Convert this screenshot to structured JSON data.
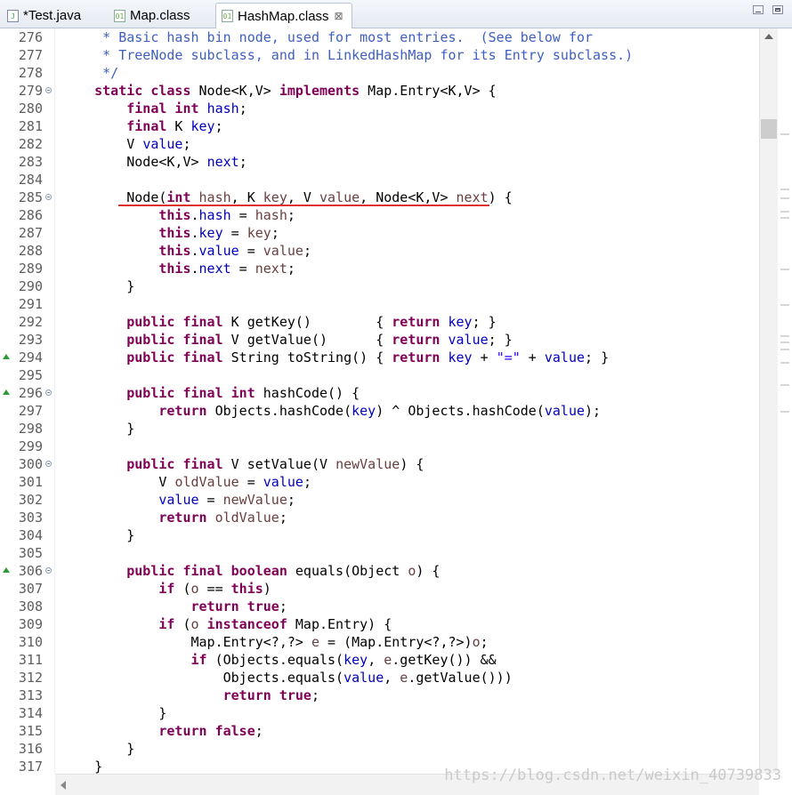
{
  "tabs": [
    {
      "label": "*Test.java",
      "icon": "java-file-icon",
      "active": false
    },
    {
      "label": "Map.class",
      "icon": "class-file-icon",
      "active": false
    },
    {
      "label": "HashMap.class",
      "icon": "class-file-icon",
      "active": true
    }
  ],
  "close_glyph": "⊠",
  "watermark": "https://blog.csdn.net/weixin_40739833",
  "colors": {
    "keyword": "#7f0055",
    "comment": "#3f5fbf",
    "field": "#0000c0",
    "param": "#6a3e3e",
    "string": "#2a00ff",
    "underline": "#e0302e"
  },
  "lines": [
    {
      "n": "276",
      "fold": false,
      "ovr": false,
      "t": [
        [
          "cm",
          "     * Basic hash bin node, used for most entries.  (See below for"
        ]
      ]
    },
    {
      "n": "277",
      "fold": false,
      "ovr": false,
      "t": [
        [
          "cm",
          "     * TreeNode subclass, and in LinkedHashMap for its Entry subclass.)"
        ]
      ]
    },
    {
      "n": "278",
      "fold": false,
      "ovr": false,
      "t": [
        [
          "cm",
          "     */"
        ]
      ]
    },
    {
      "n": "279",
      "fold": true,
      "ovr": false,
      "t": [
        [
          "",
          "    "
        ],
        [
          "kw",
          "static class"
        ],
        [
          "",
          " Node<K,V> "
        ],
        [
          "kw",
          "implements"
        ],
        [
          "",
          " Map.Entry<K,V> {"
        ]
      ]
    },
    {
      "n": "280",
      "fold": false,
      "ovr": false,
      "t": [
        [
          "",
          "        "
        ],
        [
          "kw",
          "final int"
        ],
        [
          "",
          " "
        ],
        [
          "fd",
          "hash"
        ],
        [
          "",
          ";"
        ]
      ]
    },
    {
      "n": "281",
      "fold": false,
      "ovr": false,
      "t": [
        [
          "",
          "        "
        ],
        [
          "kw",
          "final"
        ],
        [
          "",
          " K "
        ],
        [
          "fd",
          "key"
        ],
        [
          "",
          ";"
        ]
      ]
    },
    {
      "n": "282",
      "fold": false,
      "ovr": false,
      "t": [
        [
          "",
          "        V "
        ],
        [
          "fd",
          "value"
        ],
        [
          "",
          ";"
        ]
      ]
    },
    {
      "n": "283",
      "fold": false,
      "ovr": false,
      "t": [
        [
          "",
          "        Node<K,V> "
        ],
        [
          "fd",
          "next"
        ],
        [
          "",
          ";"
        ]
      ]
    },
    {
      "n": "284",
      "fold": false,
      "ovr": false,
      "t": [
        [
          "",
          ""
        ]
      ]
    },
    {
      "n": "285",
      "fold": true,
      "ovr": false,
      "t": [
        [
          "",
          "        Node("
        ],
        [
          "kw",
          "int"
        ],
        [
          "",
          " "
        ],
        [
          "pm",
          "hash"
        ],
        [
          "",
          ", K "
        ],
        [
          "pm",
          "key"
        ],
        [
          "",
          ", V "
        ],
        [
          "pm",
          "value"
        ],
        [
          "",
          ", Node<K,V> "
        ],
        [
          "pm",
          "next"
        ],
        [
          "",
          ") {"
        ]
      ]
    },
    {
      "n": "286",
      "fold": false,
      "ovr": false,
      "t": [
        [
          "",
          "            "
        ],
        [
          "kw",
          "this"
        ],
        [
          "",
          "."
        ],
        [
          "fd",
          "hash"
        ],
        [
          "",
          " = "
        ],
        [
          "pm",
          "hash"
        ],
        [
          "",
          ";"
        ]
      ]
    },
    {
      "n": "287",
      "fold": false,
      "ovr": false,
      "t": [
        [
          "",
          "            "
        ],
        [
          "kw",
          "this"
        ],
        [
          "",
          "."
        ],
        [
          "fd",
          "key"
        ],
        [
          "",
          " = "
        ],
        [
          "pm",
          "key"
        ],
        [
          "",
          ";"
        ]
      ]
    },
    {
      "n": "288",
      "fold": false,
      "ovr": false,
      "t": [
        [
          "",
          "            "
        ],
        [
          "kw",
          "this"
        ],
        [
          "",
          "."
        ],
        [
          "fd",
          "value"
        ],
        [
          "",
          " = "
        ],
        [
          "pm",
          "value"
        ],
        [
          "",
          ";"
        ]
      ]
    },
    {
      "n": "289",
      "fold": false,
      "ovr": false,
      "t": [
        [
          "",
          "            "
        ],
        [
          "kw",
          "this"
        ],
        [
          "",
          "."
        ],
        [
          "fd",
          "next"
        ],
        [
          "",
          " = "
        ],
        [
          "pm",
          "next"
        ],
        [
          "",
          ";"
        ]
      ]
    },
    {
      "n": "290",
      "fold": false,
      "ovr": false,
      "t": [
        [
          "",
          "        }"
        ]
      ]
    },
    {
      "n": "291",
      "fold": false,
      "ovr": false,
      "t": [
        [
          "",
          ""
        ]
      ]
    },
    {
      "n": "292",
      "fold": false,
      "ovr": false,
      "t": [
        [
          "",
          "        "
        ],
        [
          "kw",
          "public final"
        ],
        [
          "",
          " K getKey()        { "
        ],
        [
          "kw",
          "return"
        ],
        [
          "",
          " "
        ],
        [
          "fd",
          "key"
        ],
        [
          "",
          "; }"
        ]
      ]
    },
    {
      "n": "293",
      "fold": false,
      "ovr": false,
      "t": [
        [
          "",
          "        "
        ],
        [
          "kw",
          "public final"
        ],
        [
          "",
          " V getValue()      { "
        ],
        [
          "kw",
          "return"
        ],
        [
          "",
          " "
        ],
        [
          "fd",
          "value"
        ],
        [
          "",
          "; }"
        ]
      ]
    },
    {
      "n": "294",
      "fold": false,
      "ovr": true,
      "t": [
        [
          "",
          "        "
        ],
        [
          "kw",
          "public final"
        ],
        [
          "",
          " String toString() { "
        ],
        [
          "kw",
          "return"
        ],
        [
          "",
          " "
        ],
        [
          "fd",
          "key"
        ],
        [
          "",
          " + "
        ],
        [
          "st",
          "\"=\""
        ],
        [
          "",
          " + "
        ],
        [
          "fd",
          "value"
        ],
        [
          "",
          "; }"
        ]
      ]
    },
    {
      "n": "295",
      "fold": false,
      "ovr": false,
      "t": [
        [
          "",
          ""
        ]
      ]
    },
    {
      "n": "296",
      "fold": true,
      "ovr": true,
      "t": [
        [
          "",
          "        "
        ],
        [
          "kw",
          "public final int"
        ],
        [
          "",
          " hashCode() {"
        ]
      ]
    },
    {
      "n": "297",
      "fold": false,
      "ovr": false,
      "t": [
        [
          "",
          "            "
        ],
        [
          "kw",
          "return"
        ],
        [
          "",
          " Objects.hashCode("
        ],
        [
          "fd",
          "key"
        ],
        [
          "",
          ") ^ Objects.hashCode("
        ],
        [
          "fd",
          "value"
        ],
        [
          "",
          ");"
        ]
      ]
    },
    {
      "n": "298",
      "fold": false,
      "ovr": false,
      "t": [
        [
          "",
          "        }"
        ]
      ]
    },
    {
      "n": "299",
      "fold": false,
      "ovr": false,
      "t": [
        [
          "",
          ""
        ]
      ]
    },
    {
      "n": "300",
      "fold": true,
      "ovr": false,
      "t": [
        [
          "",
          "        "
        ],
        [
          "kw",
          "public final"
        ],
        [
          "",
          " V setValue(V "
        ],
        [
          "pm",
          "newValue"
        ],
        [
          "",
          ") {"
        ]
      ]
    },
    {
      "n": "301",
      "fold": false,
      "ovr": false,
      "t": [
        [
          "",
          "            V "
        ],
        [
          "pm",
          "oldValue"
        ],
        [
          "",
          " = "
        ],
        [
          "fd",
          "value"
        ],
        [
          "",
          ";"
        ]
      ]
    },
    {
      "n": "302",
      "fold": false,
      "ovr": false,
      "t": [
        [
          "",
          "            "
        ],
        [
          "fd",
          "value"
        ],
        [
          "",
          " = "
        ],
        [
          "pm",
          "newValue"
        ],
        [
          "",
          ";"
        ]
      ]
    },
    {
      "n": "303",
      "fold": false,
      "ovr": false,
      "t": [
        [
          "",
          "            "
        ],
        [
          "kw",
          "return"
        ],
        [
          "",
          " "
        ],
        [
          "pm",
          "oldValue"
        ],
        [
          "",
          ";"
        ]
      ]
    },
    {
      "n": "304",
      "fold": false,
      "ovr": false,
      "t": [
        [
          "",
          "        }"
        ]
      ]
    },
    {
      "n": "305",
      "fold": false,
      "ovr": false,
      "t": [
        [
          "",
          ""
        ]
      ]
    },
    {
      "n": "306",
      "fold": true,
      "ovr": true,
      "t": [
        [
          "",
          "        "
        ],
        [
          "kw",
          "public final boolean"
        ],
        [
          "",
          " equals(Object "
        ],
        [
          "pm",
          "o"
        ],
        [
          "",
          ") {"
        ]
      ]
    },
    {
      "n": "307",
      "fold": false,
      "ovr": false,
      "t": [
        [
          "",
          "            "
        ],
        [
          "kw",
          "if"
        ],
        [
          "",
          " ("
        ],
        [
          "pm",
          "o"
        ],
        [
          "",
          " == "
        ],
        [
          "kw",
          "this"
        ],
        [
          "",
          ")"
        ]
      ]
    },
    {
      "n": "308",
      "fold": false,
      "ovr": false,
      "t": [
        [
          "",
          "                "
        ],
        [
          "kw",
          "return true"
        ],
        [
          "",
          ";"
        ]
      ]
    },
    {
      "n": "309",
      "fold": false,
      "ovr": false,
      "t": [
        [
          "",
          "            "
        ],
        [
          "kw",
          "if"
        ],
        [
          "",
          " ("
        ],
        [
          "pm",
          "o"
        ],
        [
          "",
          " "
        ],
        [
          "kw",
          "instanceof"
        ],
        [
          "",
          " Map.Entry) {"
        ]
      ]
    },
    {
      "n": "310",
      "fold": false,
      "ovr": false,
      "t": [
        [
          "",
          "                Map.Entry<?,?> "
        ],
        [
          "pm",
          "e"
        ],
        [
          "",
          " = (Map.Entry<?,?>)"
        ],
        [
          "pm",
          "o"
        ],
        [
          "",
          ";"
        ]
      ]
    },
    {
      "n": "311",
      "fold": false,
      "ovr": false,
      "t": [
        [
          "",
          "                "
        ],
        [
          "kw",
          "if"
        ],
        [
          "",
          " (Objects.equals("
        ],
        [
          "fd",
          "key"
        ],
        [
          "",
          ", "
        ],
        [
          "pm",
          "e"
        ],
        [
          "",
          ".getKey()) &&"
        ]
      ]
    },
    {
      "n": "312",
      "fold": false,
      "ovr": false,
      "t": [
        [
          "",
          "                    Objects.equals("
        ],
        [
          "fd",
          "value"
        ],
        [
          "",
          ", "
        ],
        [
          "pm",
          "e"
        ],
        [
          "",
          ".getValue()))"
        ]
      ]
    },
    {
      "n": "313",
      "fold": false,
      "ovr": false,
      "t": [
        [
          "",
          "                    "
        ],
        [
          "kw",
          "return true"
        ],
        [
          "",
          ";"
        ]
      ]
    },
    {
      "n": "314",
      "fold": false,
      "ovr": false,
      "t": [
        [
          "",
          "            }"
        ]
      ]
    },
    {
      "n": "315",
      "fold": false,
      "ovr": false,
      "t": [
        [
          "",
          "            "
        ],
        [
          "kw",
          "return false"
        ],
        [
          "",
          ";"
        ]
      ]
    },
    {
      "n": "316",
      "fold": false,
      "ovr": false,
      "t": [
        [
          "",
          "        }"
        ]
      ]
    },
    {
      "n": "317",
      "fold": false,
      "ovr": false,
      "t": [
        [
          "",
          "    }"
        ]
      ]
    }
  ]
}
